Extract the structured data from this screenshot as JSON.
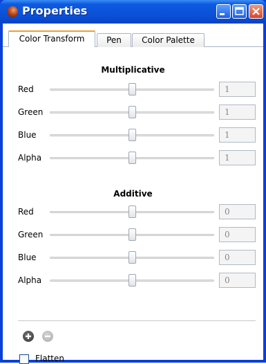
{
  "window": {
    "title": "Properties"
  },
  "tabs": [
    {
      "label": "Color Transform",
      "active": true
    },
    {
      "label": "Pen",
      "active": false
    },
    {
      "label": "Color Palette",
      "active": false
    }
  ],
  "multiplicative": {
    "title": "Multiplicative",
    "rows": [
      {
        "label": "Red",
        "value": "1",
        "slider_fraction": 0.5
      },
      {
        "label": "Green",
        "value": "1",
        "slider_fraction": 0.5
      },
      {
        "label": "Blue",
        "value": "1",
        "slider_fraction": 0.5
      },
      {
        "label": "Alpha",
        "value": "1",
        "slider_fraction": 0.5
      }
    ]
  },
  "additive": {
    "title": "Additive",
    "rows": [
      {
        "label": "Red",
        "value": "0",
        "slider_fraction": 0.5
      },
      {
        "label": "Green",
        "value": "0",
        "slider_fraction": 0.5
      },
      {
        "label": "Blue",
        "value": "0",
        "slider_fraction": 0.5
      },
      {
        "label": "Alpha",
        "value": "0",
        "slider_fraction": 0.5
      }
    ]
  },
  "actions": {
    "add_icon": "plus-circle-icon",
    "remove_icon": "minus-circle-icon"
  },
  "flatten": {
    "label": "Flatten",
    "checked": false
  },
  "colors": {
    "titlebar": "#0a4fd6",
    "active_tab_accent": "#f0a030",
    "close_button": "#d9432a"
  }
}
